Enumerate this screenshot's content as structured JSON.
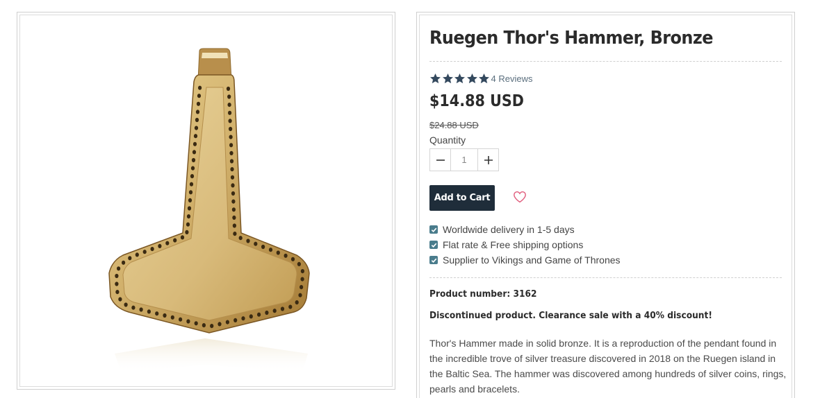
{
  "product": {
    "title": "Ruegen Thor's Hammer, Bronze",
    "rating": {
      "stars": 5,
      "reviews_label": "4 Reviews"
    },
    "price": "$14.88 USD",
    "old_price": "$24.88 USD",
    "quantity_label": "Quantity",
    "quantity_value": "1",
    "add_to_cart_label": "Add to Cart",
    "features": [
      "Worldwide delivery in 1-5 days",
      "Flat rate & Free shipping options",
      "Supplier to Vikings and Game of Thrones"
    ],
    "product_number": "Product number: 3162",
    "notice": "Discontinued product. Clearance sale with a 40% discount!",
    "description": "Thor's Hammer made in solid bronze. It is a reproduction of the pendant found in the incredible trove of silver treasure discovered in 2018 on the Ruegen island in the Baltic Sea. The hammer was discovered among hundreds of silver coins, rings, pearls and bracelets."
  },
  "colors": {
    "star": "#34495e",
    "button": "#1f2d3a",
    "heart": "#e05a7a",
    "check": "#4a7c8c",
    "bronze": "#c9a55c"
  }
}
